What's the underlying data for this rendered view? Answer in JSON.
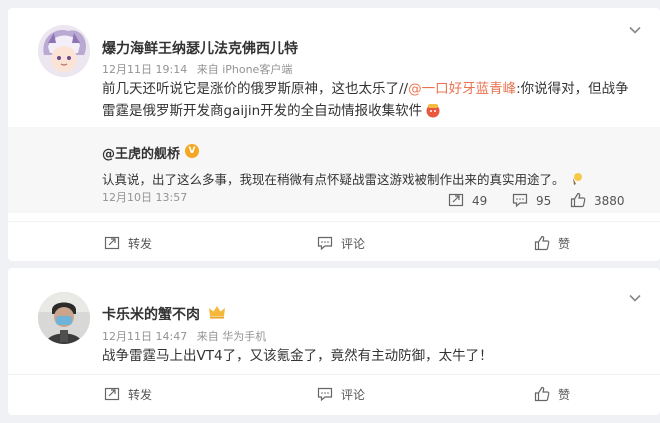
{
  "feed": {
    "posts": [
      {
        "username": "爆力海鲜王纳瑟儿法克佛西儿特",
        "date": "12月11日 19:14",
        "source": "来自 iPhone客户端",
        "text_before": "前几天还听说它是涨价的俄罗斯原神，这也太乐了//",
        "mention": "@一口好牙蓝青峰",
        "text_after": ":你说得对，但战争雷霆是俄罗斯开发商gaijin开发的全自动情报收集软件",
        "repost": {
          "username": "@王虎的舰桥",
          "text": "认真说，出了这么多事，我现在稍微有点怀疑战雷这游戏被制作出来的真实用途了。",
          "date": "12月10日 13:57",
          "reposts": "49",
          "comments": "95",
          "likes": "3880"
        },
        "actions": {
          "repost": "转发",
          "comment": "评论",
          "like": "赞"
        }
      },
      {
        "username": "卡乐米的蟹不肉",
        "date": "12月11日 14:47",
        "source": "来自 华为手机",
        "text": "战争雷霆马上出VT4了，又该氪金了，竟然有主动防御，太牛了！",
        "actions": {
          "repost": "转发",
          "comment": "评论",
          "like": "赞"
        }
      }
    ]
  },
  "icons": {
    "expand": "chevron-down-icon",
    "repost": "repost-icon",
    "comment": "comment-icon",
    "like": "thumbs-up-icon",
    "verified": "verified-badge-icon",
    "vip": "crown-icon"
  },
  "colors": {
    "mention": "#eb7350",
    "meta": "#939393",
    "background": "#f0f1f4"
  }
}
